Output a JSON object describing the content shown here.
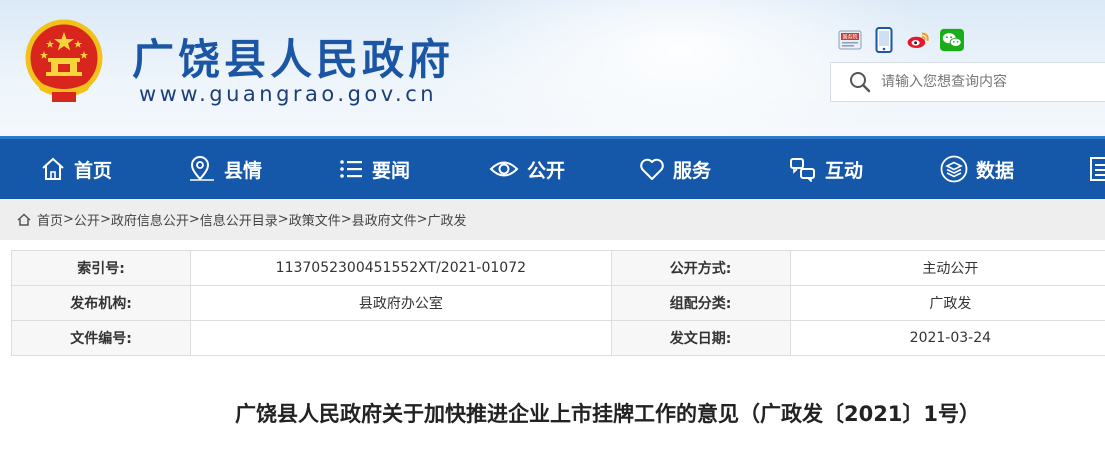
{
  "header": {
    "site_title": "广饶县人民政府",
    "site_url": "www.guangrao.gov.cn",
    "search_placeholder": "请输入您想查询内容",
    "tool_icons": [
      "gov-service-icon",
      "mobile-icon",
      "weibo-icon",
      "wechat-icon"
    ],
    "tool_badge": "国务院"
  },
  "nav": {
    "items": [
      {
        "label": "首页",
        "icon": "home-icon"
      },
      {
        "label": "县情",
        "icon": "map-pin-icon"
      },
      {
        "label": "要闻",
        "icon": "list-icon"
      },
      {
        "label": "公开",
        "icon": "eye-icon"
      },
      {
        "label": "服务",
        "icon": "heart-icon"
      },
      {
        "label": "互动",
        "icon": "interaction-icon"
      },
      {
        "label": "数据",
        "icon": "layers-icon"
      }
    ]
  },
  "breadcrumb": {
    "items": [
      "首页",
      "公开",
      "政府信息公开",
      "信息公开目录",
      "政策文件",
      "县政府文件",
      "广政发"
    ],
    "separator": ">"
  },
  "info_table": {
    "rows": [
      {
        "k1": "索引号:",
        "v1": "1137052300451552XT/2021-01072",
        "k2": "公开方式:",
        "v2": "主动公开"
      },
      {
        "k1": "发布机构:",
        "v1": "县政府办公室",
        "k2": "组配分类:",
        "v2": "广政发"
      },
      {
        "k1": "文件编号:",
        "v1": "",
        "k2": "发文日期:",
        "v2": "2021-03-24"
      }
    ]
  },
  "document": {
    "title": "广饶县人民政府关于加快推进企业上市挂牌工作的意见（广政发〔2021〕1号）"
  },
  "colors": {
    "nav_bg": "#1557a8",
    "title_blue": "#1b56a5",
    "crumb_bg": "#eeeeee"
  }
}
